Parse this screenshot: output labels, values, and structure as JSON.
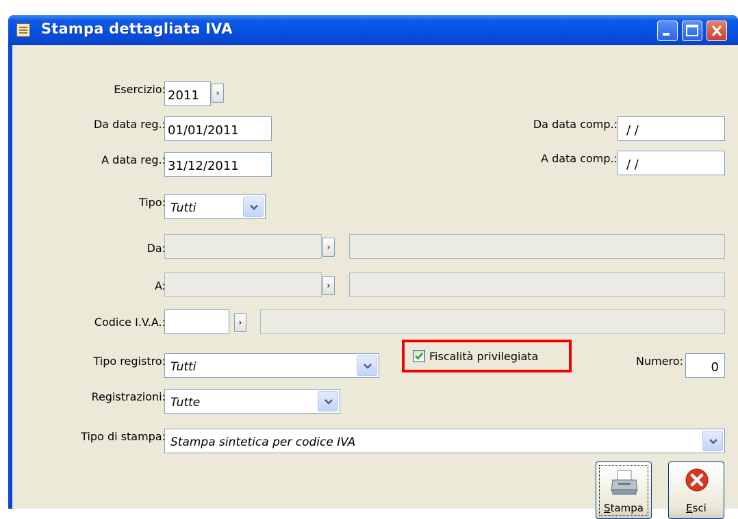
{
  "window": {
    "title": "Stampa dettagliata IVA"
  },
  "esercizio": {
    "label": "Esercizio:",
    "value": "2011"
  },
  "da_data_reg": {
    "label": "Da data reg.:",
    "value": "01/01/2011"
  },
  "a_data_reg": {
    "label": "A data reg.:",
    "value": "31/12/2011"
  },
  "da_data_comp": {
    "label": "Da data comp.:",
    "value": "/ /"
  },
  "a_data_comp": {
    "label": "A data comp.:",
    "value": "/ /"
  },
  "tipo": {
    "label": "Tipo:",
    "value": "Tutti"
  },
  "da": {
    "label": "Da:",
    "code": "",
    "description": ""
  },
  "a": {
    "label": "A:",
    "code": "",
    "description": ""
  },
  "codice_iva": {
    "label": "Codice I.V.A.:",
    "code": "",
    "description": ""
  },
  "tipo_registro": {
    "label": "Tipo registro:",
    "value": "Tutti"
  },
  "fiscalita": {
    "label": "Fiscalità privilegiata",
    "checked": true
  },
  "numero": {
    "label": "Numero:",
    "value": "0"
  },
  "registrazioni": {
    "label": "Registrazioni:",
    "value": "Tutte"
  },
  "tipo_stampa": {
    "label": "Tipo di stampa:",
    "value": "Stampa sintetica per codice IVA"
  },
  "buttons": {
    "stampa": {
      "hotkey": "S",
      "rest": "tampa"
    },
    "esci": {
      "hotkey": "E",
      "rest": "sci"
    }
  },
  "colors": {
    "title_bar": "#0553e3",
    "client_bg": "#ece9d8",
    "highlight": "#f00000",
    "close_button": "#c9402a",
    "esci_icon": "#d9381e"
  },
  "icons": {
    "app": "document-icon",
    "zoom": "zoom-arrow-icon",
    "dropdown": "chevron-down-icon",
    "stampa": "printer-icon",
    "esci": "close-x-icon"
  }
}
